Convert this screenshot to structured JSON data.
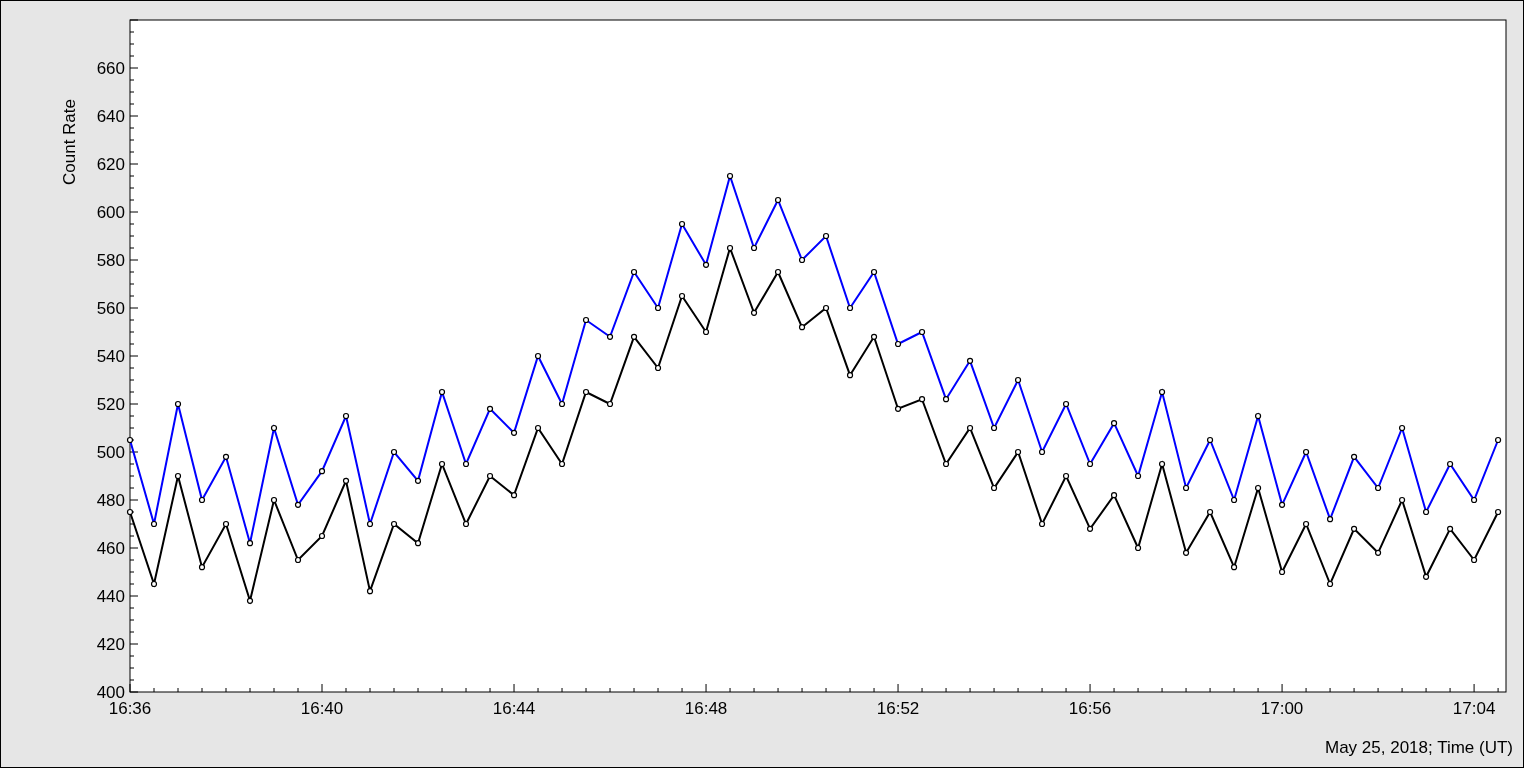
{
  "chart": {
    "chart_data": {
      "type": "line",
      "xlabel": "May 25, 2018; Time (UT)",
      "ylabel": "Count Rate",
      "categories": [
        "16:36",
        null,
        null,
        null,
        null,
        null,
        null,
        null,
        "16:40",
        null,
        null,
        null,
        null,
        null,
        null,
        null,
        "16:44",
        null,
        null,
        null,
        null,
        null,
        null,
        null,
        "16:48",
        null,
        null,
        null,
        null,
        null,
        null,
        null,
        "16:52",
        null,
        null,
        null,
        null,
        null,
        null,
        null,
        "16:56",
        null,
        null,
        null,
        null,
        null,
        null,
        null,
        "17:00",
        null,
        null,
        null,
        null,
        null,
        null,
        null,
        "17:04",
        null
      ],
      "series": [
        {
          "color": "#000000",
          "marker": "circle",
          "values": [
            475,
            445,
            490,
            452,
            470,
            438,
            480,
            455,
            465,
            488,
            442,
            470,
            462,
            495,
            470,
            490,
            482,
            510,
            495,
            525,
            520,
            548,
            535,
            565,
            550,
            585,
            558,
            575,
            552,
            560,
            532,
            548,
            518,
            522,
            495,
            510,
            485,
            500,
            470,
            490,
            468,
            482,
            460,
            495,
            458,
            475,
            452,
            485,
            450,
            470,
            445,
            468,
            458,
            480,
            448,
            468,
            455,
            475
          ]
        },
        {
          "color": "#0000ff",
          "marker": "circle",
          "values": [
            505,
            470,
            520,
            480,
            498,
            462,
            510,
            478,
            492,
            515,
            470,
            500,
            488,
            525,
            495,
            518,
            508,
            540,
            520,
            555,
            548,
            575,
            560,
            595,
            578,
            615,
            585,
            605,
            580,
            590,
            560,
            575,
            545,
            550,
            522,
            538,
            510,
            530,
            500,
            520,
            495,
            512,
            490,
            525,
            485,
            505,
            480,
            515,
            478,
            500,
            472,
            498,
            485,
            510,
            475,
            495,
            480,
            505
          ]
        }
      ],
      "ylim": [
        400,
        680
      ],
      "yticks": [
        400,
        420,
        440,
        460,
        480,
        500,
        520,
        540,
        560,
        580,
        600,
        620,
        640,
        660
      ]
    }
  }
}
